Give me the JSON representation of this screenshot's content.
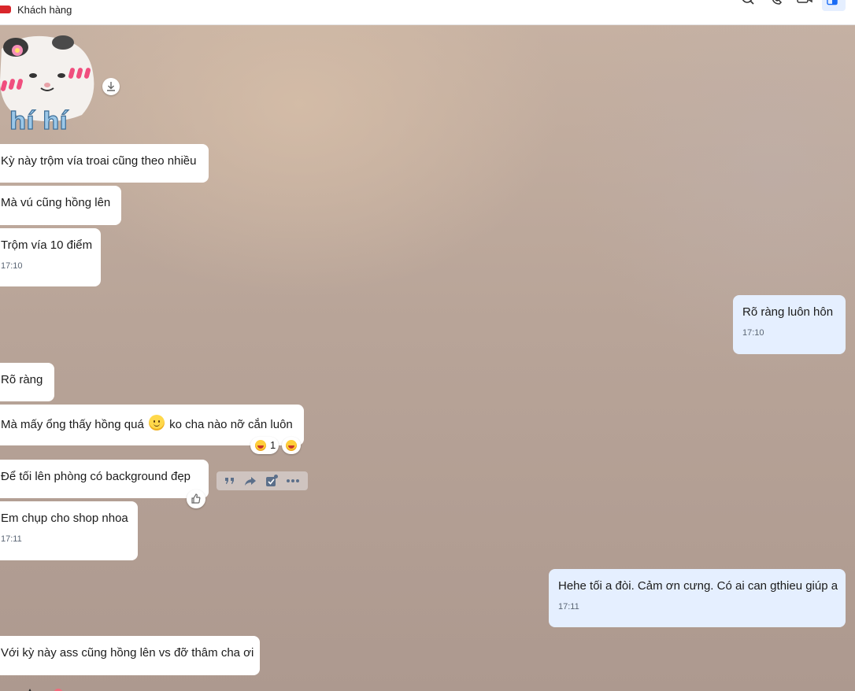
{
  "header": {
    "tag_label": "Khách hàng",
    "tag_color": "#d9262b",
    "icons": [
      "search-icon",
      "phone-icon",
      "video-call-icon",
      "layout-panel-icon"
    ]
  },
  "sticker": {
    "caption": "hí hí"
  },
  "messages": [
    {
      "side": "left",
      "text": "Kỳ này trộm vía troai cũng theo nhiều"
    },
    {
      "side": "left",
      "text": "Mà vú cũng hồng lên"
    },
    {
      "side": "left",
      "text": "Trộm vía 10 điểm",
      "time": "17:10"
    },
    {
      "side": "right",
      "text": "Rõ ràng luôn hôn",
      "time": "17:10"
    },
    {
      "side": "left",
      "text": "Rõ ràng"
    },
    {
      "side": "left",
      "text_before_emoji": "Mà mấy ổng thấy hồng quá",
      "text_after_emoji": "ko cha nào nỡ cắn luôn",
      "reaction_count": "1"
    },
    {
      "side": "left",
      "text": "Để tối lên phòng có background đẹp"
    },
    {
      "side": "left",
      "text": "Em chụp cho shop nhoa",
      "time": "17:11"
    },
    {
      "side": "right",
      "text": "Hehe tối a đòi. Cảm ơn cưng. Có ai can gthieu giúp a",
      "time": "17:11"
    },
    {
      "side": "left",
      "text": "Với kỳ này ass cũng hồng lên vs đỡ thâm cha ơi"
    }
  ],
  "colors": {
    "my_bubble": "#e5efff",
    "their_bubble": "#ffffff"
  }
}
